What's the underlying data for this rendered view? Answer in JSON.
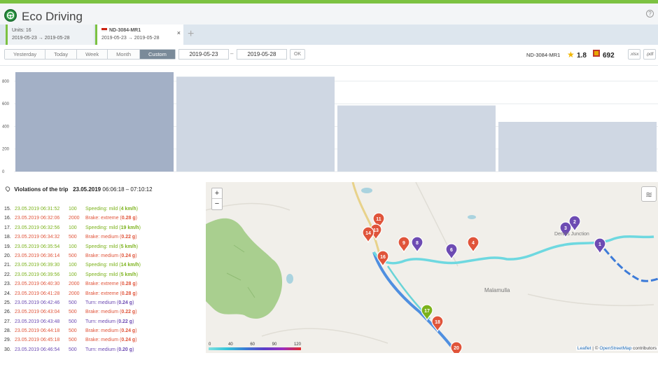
{
  "app": {
    "title": "Eco Driving",
    "help": "?"
  },
  "tabs": [
    {
      "line1": "Units: 16",
      "line2": "2019-05-23 → 2019-05-28"
    },
    {
      "line1": "ND-3084-MR1",
      "line2": "2019-05-23 → 2019-05-28",
      "close": "×"
    }
  ],
  "tab_add": "+",
  "toolbar": {
    "periods": [
      "Yesterday",
      "Today",
      "Week",
      "Month",
      "Custom"
    ],
    "selected_period": "Custom",
    "date_from": "2019-05-23",
    "date_to": "2019-05-28",
    "range_dash": "–",
    "ok": "OK",
    "unit": "ND-3084-MR1",
    "rating": "1.8",
    "points": "692",
    "export_xlsx": ".xlsx",
    "export_pdf": ".pdf"
  },
  "colors": {
    "accent": "#7cc242",
    "bar_primary": "#a3b0c6",
    "bar_secondary": "#cfd7e3"
  },
  "chart_data": {
    "type": "bar",
    "yticks": [
      0,
      200,
      400,
      600,
      800
    ],
    "ylim": [
      0,
      880
    ],
    "values": [
      880,
      840,
      585,
      440
    ],
    "xlabel": "",
    "ylabel": "",
    "title": ""
  },
  "violations": {
    "title": "Violations of the trip",
    "date": "23.05.2019",
    "time_range": "06:06:18 – 07:10:12",
    "rows": [
      {
        "n": "15.",
        "time": "23.05.2019 06:31:52",
        "val": "100",
        "pre": "Speeding: mild (",
        "bold": "4 km/h",
        "post": ")",
        "color": "#7bb21b"
      },
      {
        "n": "16.",
        "time": "23.05.2019 06:32:06",
        "val": "2000",
        "pre": "Brake: extreme (",
        "bold": "0.28 g",
        "post": ")",
        "color": "#e0543a"
      },
      {
        "n": "17.",
        "time": "23.05.2019 06:32:56",
        "val": "100",
        "pre": "Speeding: mild (",
        "bold": "19 km/h",
        "post": ")",
        "color": "#7bb21b"
      },
      {
        "n": "18.",
        "time": "23.05.2019 06:34:32",
        "val": "500",
        "pre": "Brake: medium (",
        "bold": "0.22 g",
        "post": ")",
        "color": "#e0543a"
      },
      {
        "n": "19.",
        "time": "23.05.2019 06:35:54",
        "val": "100",
        "pre": "Speeding: mild (",
        "bold": "5 km/h",
        "post": ")",
        "color": "#7bb21b"
      },
      {
        "n": "20.",
        "time": "23.05.2019 06:36:14",
        "val": "500",
        "pre": "Brake: medium (",
        "bold": "0.24 g",
        "post": ")",
        "color": "#e0543a"
      },
      {
        "n": "21.",
        "time": "23.05.2019 06:39:30",
        "val": "100",
        "pre": "Speeding: mild (",
        "bold": "14 km/h",
        "post": ")",
        "color": "#7bb21b"
      },
      {
        "n": "22.",
        "time": "23.05.2019 06:39:56",
        "val": "100",
        "pre": "Speeding: mild (",
        "bold": "5 km/h",
        "post": ")",
        "color": "#7bb21b"
      },
      {
        "n": "23.",
        "time": "23.05.2019 06:40:30",
        "val": "2000",
        "pre": "Brake: extreme (",
        "bold": "0.28 g",
        "post": ")",
        "color": "#e0543a"
      },
      {
        "n": "24.",
        "time": "23.05.2019 06:41:28",
        "val": "2000",
        "pre": "Brake: extreme (",
        "bold": "0.28 g",
        "post": ")",
        "color": "#e0543a"
      },
      {
        "n": "25.",
        "time": "23.05.2019 06:42:46",
        "val": "500",
        "pre": "Turn: medium (",
        "bold": "0.24 g",
        "post": ")",
        "color": "#6d4bb3"
      },
      {
        "n": "26.",
        "time": "23.05.2019 06:43:04",
        "val": "500",
        "pre": "Brake: medium (",
        "bold": "0.22 g",
        "post": ")",
        "color": "#e0543a"
      },
      {
        "n": "27.",
        "time": "23.05.2019 06:43:48",
        "val": "500",
        "pre": "Turn: medium (",
        "bold": "0.22 g",
        "post": ")",
        "color": "#6d4bb3"
      },
      {
        "n": "28.",
        "time": "23.05.2019 06:44:18",
        "val": "500",
        "pre": "Brake: medium (",
        "bold": "0.24 g",
        "post": ")",
        "color": "#e0543a"
      },
      {
        "n": "29.",
        "time": "23.05.2019 06:45:18",
        "val": "500",
        "pre": "Brake: medium (",
        "bold": "0.24 g",
        "post": ")",
        "color": "#e0543a"
      },
      {
        "n": "30.",
        "time": "23.05.2019 06:46:54",
        "val": "500",
        "pre": "Turn: medium (",
        "bold": "0.20 g",
        "post": ")",
        "color": "#6d4bb3"
      }
    ]
  },
  "map": {
    "zoom_in": "+",
    "zoom_out": "−",
    "places": [
      "Malamulla",
      "Dennis Junction"
    ],
    "legend_ticks": [
      "0",
      "40",
      "60",
      "90",
      "120"
    ],
    "attribution_leaflet": "Leaflet",
    "attribution_sep": " | © ",
    "attribution_osm": "OpenStreetMap",
    "attribution_tail": " contributors",
    "markers": [
      "1",
      "2",
      "3",
      "4",
      "6",
      "8",
      "9",
      "11",
      "13",
      "14",
      "16",
      "17",
      "18",
      "20"
    ]
  }
}
